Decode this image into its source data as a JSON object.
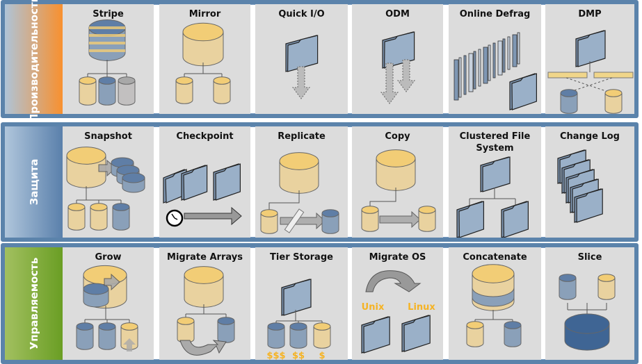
{
  "colors": {
    "frame": "#5b83ab",
    "tile": "#dcdcdc",
    "yellow": "#f2cd76",
    "blue": "#5f7ea6",
    "folder": "#9ab0c8",
    "money": "#f5b324"
  },
  "rows": [
    {
      "label": "Производительность",
      "gradient": [
        "#afc4d8",
        "#f8902f"
      ],
      "tiles": [
        {
          "title": "Stripe",
          "icon": "stripe"
        },
        {
          "title": "Mirror",
          "icon": "mirror"
        },
        {
          "title": "Quick I/O",
          "icon": "quickio"
        },
        {
          "title": "ODM",
          "icon": "odm"
        },
        {
          "title": "Online Defrag",
          "icon": "defrag"
        },
        {
          "title": "DMP",
          "icon": "dmp"
        }
      ]
    },
    {
      "label": "Защита",
      "gradient": [
        "#b0c6dc",
        "#5a80ab"
      ],
      "tiles": [
        {
          "title": "Snapshot",
          "icon": "snapshot"
        },
        {
          "title": "Checkpoint",
          "icon": "checkpoint"
        },
        {
          "title": "Replicate",
          "icon": "replicate"
        },
        {
          "title": "Copy",
          "icon": "copy"
        },
        {
          "title": "Clustered File System",
          "icon": "cfs"
        },
        {
          "title": "Change Log",
          "icon": "changelog"
        }
      ]
    },
    {
      "label": "Управляемость",
      "gradient": [
        "#a2c060",
        "#6a9e24"
      ],
      "tiles": [
        {
          "title": "Grow",
          "icon": "grow"
        },
        {
          "title": "Migrate Arrays",
          "icon": "migratearrays"
        },
        {
          "title": "Tier Storage",
          "icon": "tier",
          "labels": [
            "$$$",
            "$$",
            "$"
          ]
        },
        {
          "title": "Migrate OS",
          "icon": "migrateos",
          "labels": [
            "Unix",
            "Linux"
          ]
        },
        {
          "title": "Concatenate",
          "icon": "concat"
        },
        {
          "title": "Slice",
          "icon": "slice"
        }
      ]
    }
  ]
}
